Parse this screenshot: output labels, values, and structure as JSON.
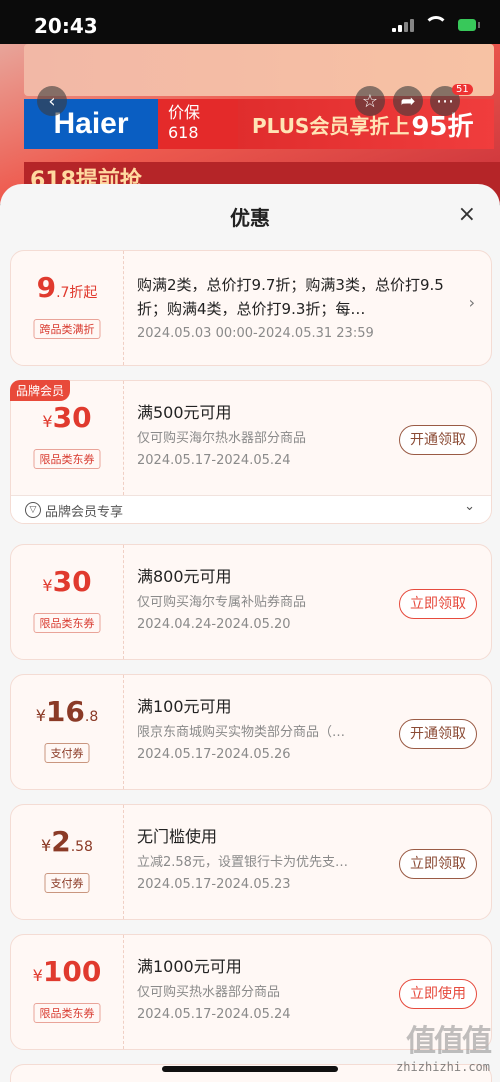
{
  "status": {
    "time": "20:43"
  },
  "background": {
    "brand": "Haier",
    "promo_line1": "价保",
    "promo_line2": "618",
    "plus_text": "PLUS会员享折上",
    "plus_discount": "95折",
    "strip_text": "618提前抢",
    "badge_count": "51"
  },
  "sheet": {
    "title": "优惠",
    "close": "×"
  },
  "cards": [
    {
      "amount_big": "9",
      "amount_small": ".7折起",
      "tag": "跨品类满折",
      "line1": "购满2类，总价打9.7折；购满3类，总价打9.5折；购满4类，总价打9.3折；每…",
      "line2": "2024.05.03 00:00-2024.05.31 23:59"
    },
    {
      "ribbon": "品牌会员",
      "currency": "¥",
      "amount_big": "30",
      "tag": "限品类东券",
      "line1": "满500元可用",
      "line2": "仅可购买海尔热水器部分商品",
      "line3": "2024.05.17-2024.05.24",
      "cta": "开通领取",
      "footer": "品牌会员专享"
    },
    {
      "currency": "¥",
      "amount_big": "30",
      "tag": "限品类东券",
      "line1": "满800元可用",
      "line2": "仅可购买海尔专属补贴券商品",
      "line3": "2024.04.24-2024.05.20",
      "cta": "立即领取"
    },
    {
      "currency": "¥",
      "amount_big": "16",
      "amount_small": ".8",
      "tag": "支付券",
      "line1": "满100元可用",
      "line2": "限京东商城购买实物类部分商品（…",
      "line3": "2024.05.17-2024.05.26",
      "cta": "开通领取"
    },
    {
      "currency": "¥",
      "amount_big": "2",
      "amount_small": ".58",
      "tag": "支付券",
      "line1": "无门槛使用",
      "line2": "立减2.58元，设置银行卡为优先支…",
      "line3": "2024.05.17-2024.05.23",
      "cta": "立即领取"
    },
    {
      "currency": "¥",
      "amount_big": "100",
      "tag": "限品类东券",
      "line1": "满1000元可用",
      "line2": "仅可购买热水器部分商品",
      "line3": "2024.05.17-2024.05.24",
      "cta": "立即使用"
    }
  ],
  "watermark": {
    "text": "zhizhizhi.com",
    "logo": "值值值"
  },
  "icons": [
    "back-icon",
    "star-icon",
    "share-icon",
    "more-icon",
    "close-icon",
    "chevron-right-icon",
    "chevron-down-icon",
    "member-icon"
  ]
}
